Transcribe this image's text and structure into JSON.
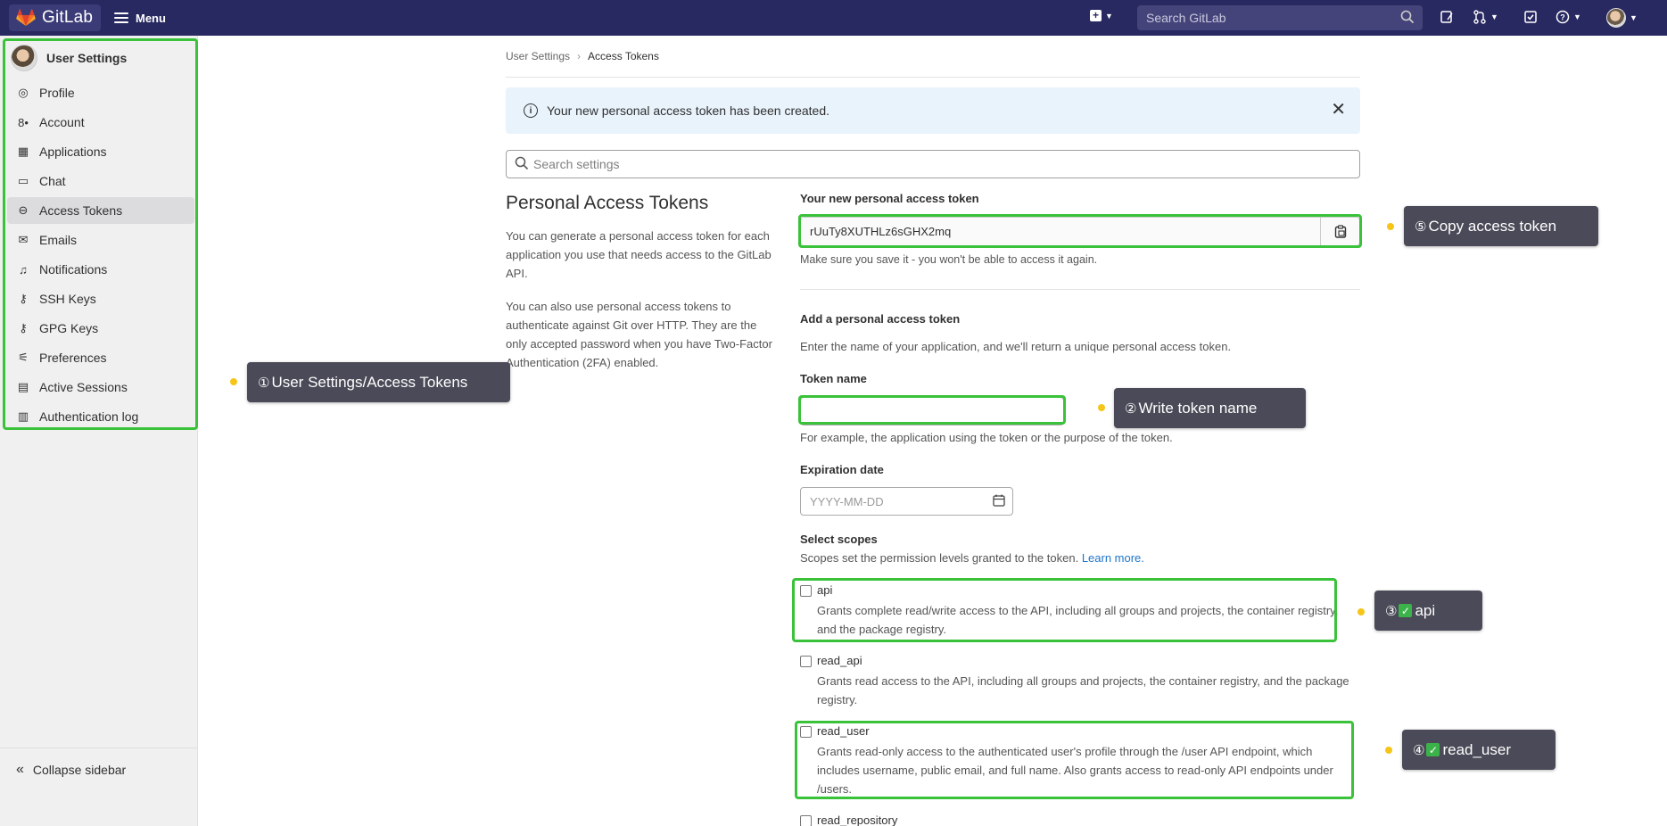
{
  "topbar": {
    "brand": "GitLab",
    "menu_label": "Menu",
    "search_placeholder": "Search GitLab"
  },
  "sidebar": {
    "title": "User Settings",
    "items": [
      {
        "label": "Profile",
        "icon": "profile-icon"
      },
      {
        "label": "Account",
        "icon": "account-icon"
      },
      {
        "label": "Applications",
        "icon": "applications-icon"
      },
      {
        "label": "Chat",
        "icon": "chat-icon"
      },
      {
        "label": "Access Tokens",
        "icon": "token-icon"
      },
      {
        "label": "Emails",
        "icon": "mail-icon"
      },
      {
        "label": "Notifications",
        "icon": "bell-icon"
      },
      {
        "label": "SSH Keys",
        "icon": "key-icon"
      },
      {
        "label": "GPG Keys",
        "icon": "key-icon"
      },
      {
        "label": "Preferences",
        "icon": "preferences-icon"
      },
      {
        "label": "Active Sessions",
        "icon": "monitor-icon"
      },
      {
        "label": "Authentication log",
        "icon": "log-icon"
      }
    ],
    "collapse_label": "Collapse sidebar"
  },
  "breadcrumb": {
    "parent": "User Settings",
    "current": "Access Tokens"
  },
  "alert": {
    "message": "Your new personal access token has been created."
  },
  "settings_search_placeholder": "Search settings",
  "intro": {
    "title": "Personal Access Tokens",
    "para1": "You can generate a personal access token for each application you use that needs access to the GitLab API.",
    "para2": "You can also use personal access tokens to authenticate against Git over HTTP. They are the only accepted password when you have Two-Factor Authentication (2FA) enabled."
  },
  "new_token": {
    "label": "Your new personal access token",
    "value": "rUuTy8XUTHLz6sGHX2mq",
    "help": "Make sure you save it - you won't be able to access it again."
  },
  "add_token": {
    "heading": "Add a personal access token",
    "subtext": "Enter the name of your application, and we'll return a unique personal access token.",
    "name_label": "Token name",
    "name_value": "",
    "name_help": "For example, the application using the token or the purpose of the token.",
    "expiration_label": "Expiration date",
    "expiration_placeholder": "YYYY-MM-DD"
  },
  "scopes": {
    "heading": "Select scopes",
    "subtext": "Scopes set the permission levels granted to the token.",
    "learn_more": "Learn more.",
    "items": [
      {
        "name": "api",
        "desc": "Grants complete read/write access to the API, including all groups and projects, the container registry, and the package registry.",
        "checked": false
      },
      {
        "name": "read_api",
        "desc": "Grants read access to the API, including all groups and projects, the container registry, and the package registry.",
        "checked": false
      },
      {
        "name": "read_user",
        "desc": "Grants read-only access to the authenticated user's profile through the /user API endpoint, which includes username, public email, and full name. Also grants access to read-only API endpoints under /users.",
        "checked": false
      },
      {
        "name": "read_repository",
        "desc": "",
        "checked": false
      }
    ]
  },
  "callouts": {
    "c1": {
      "num": "①",
      "text": "User Settings/Access Tokens"
    },
    "c2": {
      "num": "②",
      "text": "Write token name"
    },
    "c3": {
      "num": "③",
      "check": "✓",
      "text": "api"
    },
    "c4": {
      "num": "④",
      "check": "✓",
      "text": "read_user"
    },
    "c5": {
      "num": "⑤",
      "text": "Copy access token"
    }
  },
  "colors": {
    "topbar": "#292961",
    "highlight": "#3ac23a",
    "callout": "#4a4a58",
    "callout_dot": "#f5c518",
    "link": "#1f75cb",
    "alert_bg": "#e9f3fc"
  }
}
